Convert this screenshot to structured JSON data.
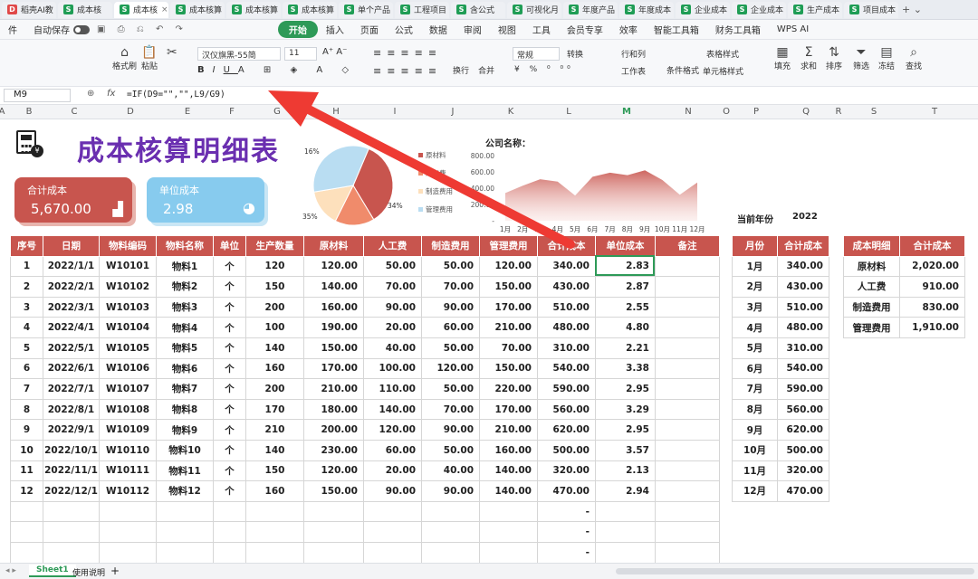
{
  "tabs": [
    {
      "label": "稻壳AI教",
      "icon": "D",
      "active": false
    },
    {
      "label": "成本核",
      "icon": "S",
      "active": false
    },
    {
      "label": "成本核",
      "icon": "S",
      "active": true
    },
    {
      "label": "成本核算",
      "icon": "S",
      "active": false
    },
    {
      "label": "成本核算",
      "icon": "S",
      "active": false
    },
    {
      "label": "成本核算",
      "icon": "S",
      "active": false
    },
    {
      "label": "单个产品",
      "icon": "S",
      "active": false
    },
    {
      "label": "工程项目",
      "icon": "S",
      "active": false
    },
    {
      "label": "含公式",
      "icon": "S",
      "active": false
    },
    {
      "label": "可视化月",
      "icon": "S",
      "active": false
    },
    {
      "label": "年度产品",
      "icon": "S",
      "active": false
    },
    {
      "label": "年度成本",
      "icon": "S",
      "active": false
    },
    {
      "label": "企业成本",
      "icon": "S",
      "active": false
    },
    {
      "label": "企业成本",
      "icon": "S",
      "active": false
    },
    {
      "label": "生产成本",
      "icon": "S",
      "active": false
    },
    {
      "label": "项目成本",
      "icon": "S",
      "active": false
    }
  ],
  "menu": {
    "file": "件",
    "autosave": "自动保存",
    "items": [
      "开始",
      "插入",
      "页面",
      "公式",
      "数据",
      "审阅",
      "视图",
      "工具",
      "会员专享",
      "效率",
      "智能工具箱",
      "财务工具箱",
      "WPS AI"
    ]
  },
  "ribbon": {
    "format_painter": "格式刷",
    "paste": "粘贴",
    "font": "汉仪旗黑-55简",
    "size": "11",
    "number_format": "常规",
    "convert": "转换",
    "wrap": "换行",
    "merge": "合并",
    "row_col": "行和列",
    "worksheet": "工作表",
    "cond_format": "条件格式",
    "table_style": "表格样式",
    "cell_style": "单元格样式",
    "fill": "填充",
    "sum": "求和",
    "sort": "排序",
    "filter": "筛选",
    "freeze": "冻结",
    "find": "查找"
  },
  "formula_bar": {
    "cell_ref": "M9",
    "fx": "fx",
    "formula": "=IF(D9=\"\",\"\",L9/G9)"
  },
  "columns": [
    "A",
    "B",
    "C",
    "D",
    "E",
    "F",
    "G",
    "H",
    "I",
    "J",
    "K",
    "L",
    "M",
    "N",
    "O",
    "P",
    "Q",
    "R",
    "S",
    "T"
  ],
  "title": "成本核算明细表",
  "cards": [
    {
      "label": "合计成本",
      "value": "5,670.00"
    },
    {
      "label": "单位成本",
      "value": "2.98"
    }
  ],
  "company_label": "公司名称：",
  "current_year_label": "当前年份",
  "current_year": "2022",
  "pie": {
    "slices": [
      {
        "name": "原材料",
        "pct": 35,
        "color": "#c8554e"
      },
      {
        "name": "人工费",
        "pct": 16,
        "color": "#f08b6b"
      },
      {
        "name": "制造费用",
        "pct": 15,
        "color": "#fde0bc"
      },
      {
        "name": "管理费用",
        "pct": 34,
        "color": "#b9ddf2"
      }
    ],
    "labels": [
      "16%",
      "35%",
      "34%"
    ]
  },
  "area_chart": {
    "yticks": [
      "800.00",
      "600.00",
      "400.00",
      "200.00",
      "-"
    ],
    "months": [
      "1月",
      "2月",
      "3月",
      "4月",
      "5月",
      "6月",
      "7月",
      "8月",
      "9月",
      "10月",
      "11月",
      "12月"
    ],
    "values": [
      340,
      430,
      510,
      480,
      310,
      540,
      590,
      560,
      620,
      500,
      320,
      470
    ],
    "ymax": 800
  },
  "main_table": {
    "headers": [
      "序号",
      "日期",
      "物料编码",
      "物料名称",
      "单位",
      "生产数量",
      "原材料",
      "人工费",
      "制造费用",
      "管理费用",
      "合计成本",
      "单位成本",
      "备注"
    ],
    "rows": [
      [
        "1",
        "2022/1/1",
        "W10101",
        "物料1",
        "个",
        "120",
        "120.00",
        "50.00",
        "50.00",
        "120.00",
        "340.00",
        "2.83",
        ""
      ],
      [
        "2",
        "2022/2/1",
        "W10102",
        "物料2",
        "个",
        "150",
        "140.00",
        "70.00",
        "70.00",
        "150.00",
        "430.00",
        "2.87",
        ""
      ],
      [
        "3",
        "2022/3/1",
        "W10103",
        "物料3",
        "个",
        "200",
        "160.00",
        "90.00",
        "90.00",
        "170.00",
        "510.00",
        "2.55",
        ""
      ],
      [
        "4",
        "2022/4/1",
        "W10104",
        "物料4",
        "个",
        "100",
        "190.00",
        "20.00",
        "60.00",
        "210.00",
        "480.00",
        "4.80",
        ""
      ],
      [
        "5",
        "2022/5/1",
        "W10105",
        "物料5",
        "个",
        "140",
        "150.00",
        "40.00",
        "50.00",
        "70.00",
        "310.00",
        "2.21",
        ""
      ],
      [
        "6",
        "2022/6/1",
        "W10106",
        "物料6",
        "个",
        "160",
        "170.00",
        "100.00",
        "120.00",
        "150.00",
        "540.00",
        "3.38",
        ""
      ],
      [
        "7",
        "2022/7/1",
        "W10107",
        "物料7",
        "个",
        "200",
        "210.00",
        "110.00",
        "50.00",
        "220.00",
        "590.00",
        "2.95",
        ""
      ],
      [
        "8",
        "2022/8/1",
        "W10108",
        "物料8",
        "个",
        "170",
        "180.00",
        "140.00",
        "70.00",
        "170.00",
        "560.00",
        "3.29",
        ""
      ],
      [
        "9",
        "2022/9/1",
        "W10109",
        "物料9",
        "个",
        "210",
        "200.00",
        "120.00",
        "90.00",
        "210.00",
        "620.00",
        "2.95",
        ""
      ],
      [
        "10",
        "2022/10/1",
        "W10110",
        "物料10",
        "个",
        "140",
        "230.00",
        "60.00",
        "50.00",
        "160.00",
        "500.00",
        "3.57",
        ""
      ],
      [
        "11",
        "2022/11/1",
        "W10111",
        "物料11",
        "个",
        "150",
        "120.00",
        "20.00",
        "40.00",
        "140.00",
        "320.00",
        "2.13",
        ""
      ],
      [
        "12",
        "2022/12/1",
        "W10112",
        "物料12",
        "个",
        "160",
        "150.00",
        "90.00",
        "90.00",
        "140.00",
        "470.00",
        "2.94",
        ""
      ]
    ],
    "empty_rows": [
      [
        "",
        "",
        "",
        "",
        "",
        "",
        "",
        "",
        "",
        "",
        "-",
        "",
        ""
      ],
      [
        "",
        "",
        "",
        "",
        "",
        "",
        "",
        "",
        "",
        "",
        "-",
        "",
        ""
      ],
      [
        "",
        "",
        "",
        "",
        "",
        "",
        "",
        "",
        "",
        "",
        "-",
        "",
        ""
      ]
    ]
  },
  "month_table": {
    "headers": [
      "月份",
      "合计成本"
    ],
    "rows": [
      [
        "1月",
        "340.00"
      ],
      [
        "2月",
        "430.00"
      ],
      [
        "3月",
        "510.00"
      ],
      [
        "4月",
        "480.00"
      ],
      [
        "5月",
        "310.00"
      ],
      [
        "6月",
        "540.00"
      ],
      [
        "7月",
        "590.00"
      ],
      [
        "8月",
        "560.00"
      ],
      [
        "9月",
        "620.00"
      ],
      [
        "10月",
        "500.00"
      ],
      [
        "11月",
        "320.00"
      ],
      [
        "12月",
        "470.00"
      ]
    ]
  },
  "detail_table": {
    "headers": [
      "成本明细",
      "合计成本"
    ],
    "rows": [
      [
        "原材料",
        "2,020.00"
      ],
      [
        "人工费",
        "910.00"
      ],
      [
        "制造费用",
        "830.00"
      ],
      [
        "管理费用",
        "1,910.00"
      ]
    ]
  },
  "sheets": [
    "Sheet1",
    "使用说明"
  ]
}
